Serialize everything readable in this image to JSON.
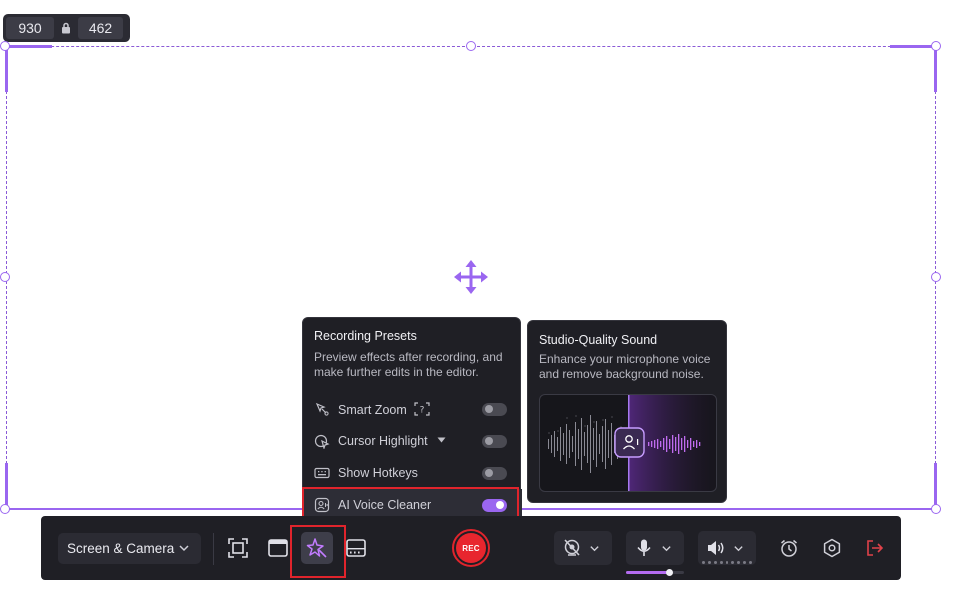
{
  "size_badge": {
    "width": "930",
    "height": "462",
    "lock_icon": "lock-icon"
  },
  "presets": {
    "title": "Recording Presets",
    "description": "Preview effects after recording, and make further edits in the editor.",
    "items": [
      {
        "label": "Smart Zoom",
        "icon": "smart-zoom-icon",
        "enabled": false
      },
      {
        "label": "Cursor Highlight",
        "icon": "cursor-highlight-icon",
        "enabled": false
      },
      {
        "label": "Show Hotkeys",
        "icon": "keyboard-icon",
        "enabled": false
      },
      {
        "label": "AI Voice Cleaner",
        "icon": "ai-voice-icon",
        "enabled": true
      }
    ]
  },
  "studio": {
    "title": "Studio-Quality Sound",
    "description": "Enhance your microphone voice and remove background noise."
  },
  "toolbar": {
    "mode": "Screen & Camera",
    "rec_label": "REC",
    "mic_level": 0.75,
    "accent": "#9a66f0",
    "record_color": "#e8262e",
    "exit_color": "#e0424a"
  }
}
